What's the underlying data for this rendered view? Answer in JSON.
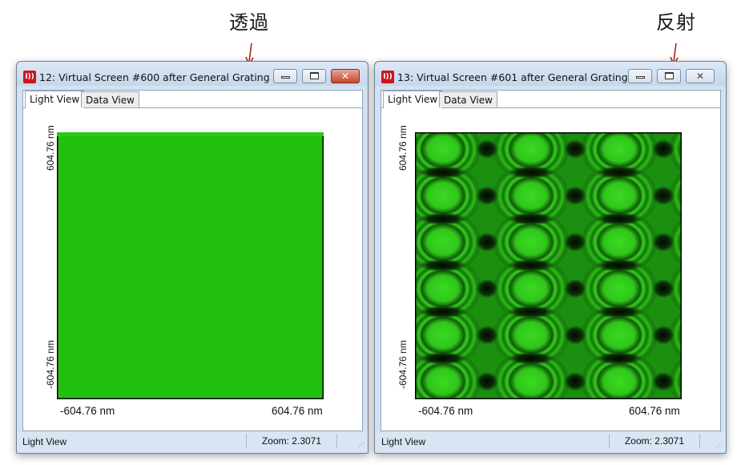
{
  "annotations": {
    "transmission": "透過",
    "reflection": "反射"
  },
  "windows": [
    {
      "title": "12: Virtual Screen #600 after General Grating ...",
      "app_icon": "I))",
      "tabs": [
        "Light View",
        "Data View"
      ],
      "active_tab": "Light View",
      "y_top_label": "604.76 nm",
      "y_bottom_label": "-604.76 nm",
      "x_left_label": "-604.76 nm",
      "x_right_label": "604.76 nm",
      "status_left": "Light View",
      "status_zoom": "Zoom: 2.3071",
      "active": true,
      "image": "uniform-green-field"
    },
    {
      "title": "13: Virtual Screen #601 after General Grating ...",
      "app_icon": "I))",
      "tabs": [
        "Light View",
        "Data View"
      ],
      "active_tab": "Light View",
      "y_top_label": "604.76 nm",
      "y_bottom_label": "-604.76 nm",
      "x_left_label": "-604.76 nm",
      "x_right_label": "604.76 nm",
      "status_left": "Light View",
      "status_zoom": "Zoom: 2.3071",
      "active": false,
      "image": "green-periodic-interference-pattern"
    }
  ],
  "colors": {
    "field_green": "#22c00e",
    "pattern_dark": "#0b2a06",
    "pattern_bright": "#34d61c",
    "arrow": "#b0221e"
  }
}
